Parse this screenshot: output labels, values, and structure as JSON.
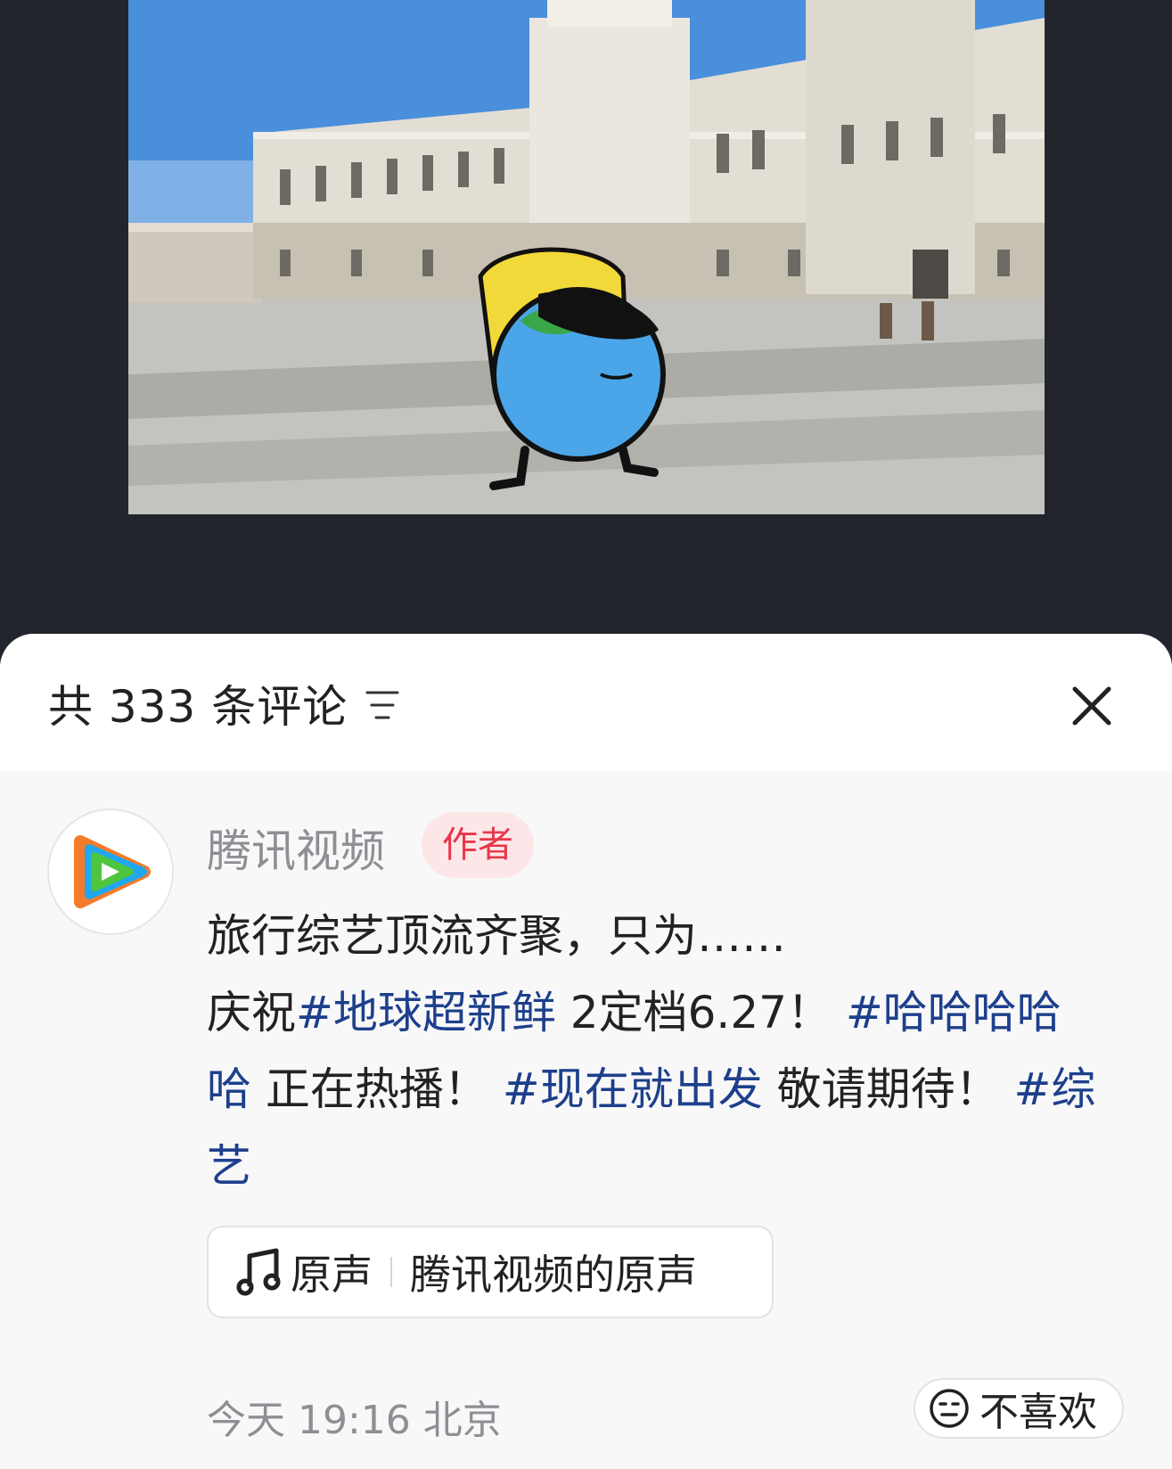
{
  "sheet": {
    "title": "共 333 条评论",
    "filter_icon": "filter-icon",
    "close_icon": "close-icon"
  },
  "comment": {
    "username": "腾讯视频",
    "badge": "作者",
    "text_line1": "旅行综艺顶流齐聚，只为……",
    "text_prefix": "庆祝",
    "hashtag1": "#地球超新鲜",
    "text_mid1": " 2定档6.27！ ",
    "hashtag2": "#哈哈哈哈哈",
    "text_mid2": " 正在热播！ ",
    "hashtag3": "#现在就出发",
    "text_mid3": " 敬请期待！ ",
    "hashtag4": "#综艺",
    "music": {
      "icon": "music-note-icon",
      "label": "原声",
      "name": "腾讯视频的原声"
    },
    "timestamp": "今天 19:16 北京",
    "dislike_label": "不喜欢",
    "dislike_icon": "neutral-face-icon"
  },
  "colors": {
    "hashtag": "#1d3f8c",
    "badge_text": "#e8364a",
    "badge_bg": "#fde6e8",
    "overlay_bg": "#22252b"
  }
}
